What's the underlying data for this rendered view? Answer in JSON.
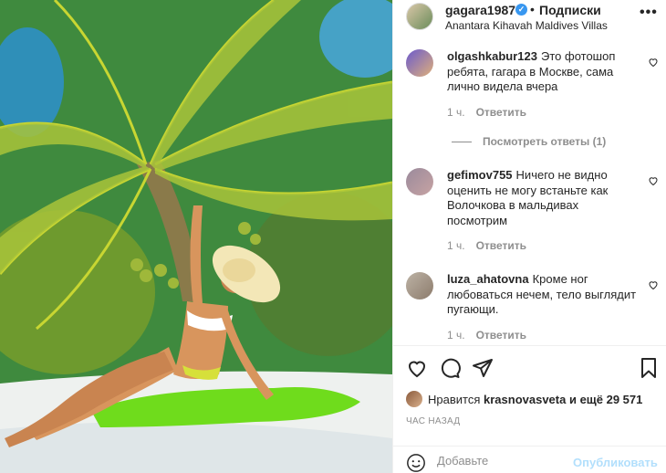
{
  "post": {
    "username": "gagara1987",
    "follow_label": "Подписки",
    "location": "Anantara Kihavah Maldives Villas",
    "more_icon": "more-horizontal-icon"
  },
  "comments": [
    {
      "username": "olgashkabur123",
      "text": "Это фотошоп ребята, гагара в Москве, сама лично видела вчера",
      "time": "1 ч.",
      "reply_label": "Ответить"
    },
    {
      "username": "gefimov755",
      "text": "Ничего не видно оценить не могу встаньте как Волочкова в мальдивах посмотрим",
      "time": "1 ч.",
      "reply_label": "Ответить"
    },
    {
      "username": "luza_ahatovna",
      "text": "Кроме ног любоваться нечем, тело выглядит пугающи.",
      "time": "1 ч.",
      "reply_label": "Ответить"
    }
  ],
  "view_replies": "Посмотреть ответы (1)",
  "likes": {
    "prefix": "Нравится",
    "user": "krasnovasveta",
    "suffix": "и ещё 29 571"
  },
  "timestamp": "ЧАС НАЗАД",
  "add_comment": {
    "placeholder": "Добавьте",
    "publish_label": "Опубликовать"
  },
  "colors": {
    "accent_disabled": "#b2dffc",
    "verified": "#3897f0",
    "muted": "#8e8e8e"
  }
}
